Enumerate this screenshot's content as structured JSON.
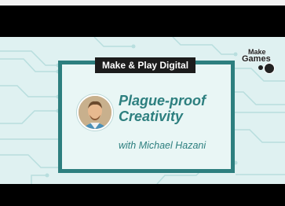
{
  "video": {
    "badge": "Make & Play Digital",
    "title_line1": "Plague-proof",
    "title_line2": "Creativity",
    "byline": "with Michael Hazani"
  },
  "logo": {
    "make": "Make",
    "games": "Games"
  },
  "colors": {
    "accent_teal": "#2d7f7f",
    "background_mint": "#dff1f1",
    "circuit_lines": "#b8dede",
    "badge_background": "#1c1c1c"
  }
}
